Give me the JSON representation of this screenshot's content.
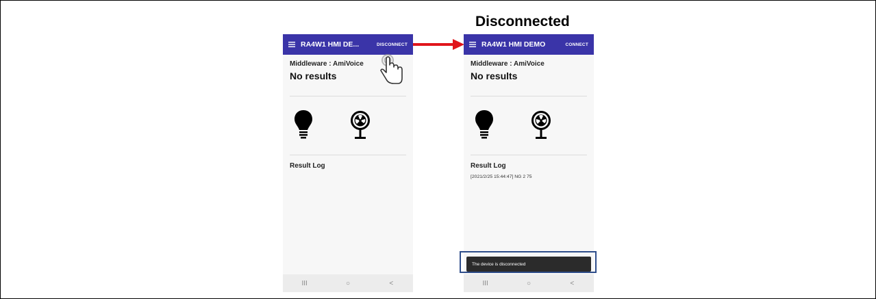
{
  "heading": "Disconnected",
  "left_phone": {
    "app_title": "RA4W1 HMI DE...",
    "action": "DISCONNECT",
    "middleware": "Middleware : AmiVoice",
    "results": "No results",
    "log_title": "Result Log",
    "log_entries": []
  },
  "right_phone": {
    "app_title": "RA4W1 HMI DEMO",
    "action": "CONNECT",
    "middleware": "Middleware : AmiVoice",
    "results": "No results",
    "log_title": "Result Log",
    "log_entries": [
      "[2021/2/25 15:44:47] NG 2 75"
    ],
    "toast": "The device is disconnected"
  },
  "navbar": {
    "recent": "III",
    "home": "○",
    "back": "<"
  },
  "colors": {
    "appbar": "#3a34a8",
    "arrow": "#e0151b",
    "highlight": "#2e4d8a",
    "toast": "#2b2b2b"
  },
  "icons": [
    "menu-icon",
    "lightbulb-icon",
    "fan-icon",
    "pointing-hand-icon",
    "arrow-right-icon"
  ]
}
